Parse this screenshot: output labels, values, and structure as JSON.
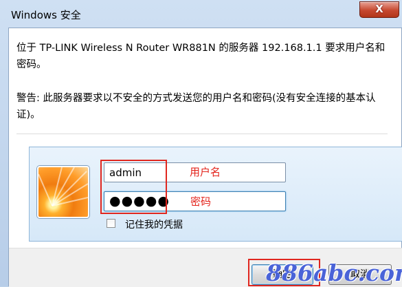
{
  "window": {
    "title": "Windows 安全",
    "close_label": "X"
  },
  "message": {
    "line1": "位于 TP-LINK Wireless N Router WR881N 的服务器 192.168.1.1 要求用户名和密码。",
    "warning": "警告: 此服务器要求以不安全的方式发送您的用户名和密码(没有安全连接的基本认证)。"
  },
  "credentials": {
    "username_value": "admin",
    "password_value": "●●●●●",
    "remember_label": "记住我的凭据",
    "remember_checked": false
  },
  "annotations": {
    "username_note": "用户名",
    "password_note": "密码",
    "accent_color": "#e3231b"
  },
  "buttons": {
    "ok_label": "确定",
    "cancel_label": "取消"
  },
  "watermark": {
    "text": "886abc.com"
  }
}
